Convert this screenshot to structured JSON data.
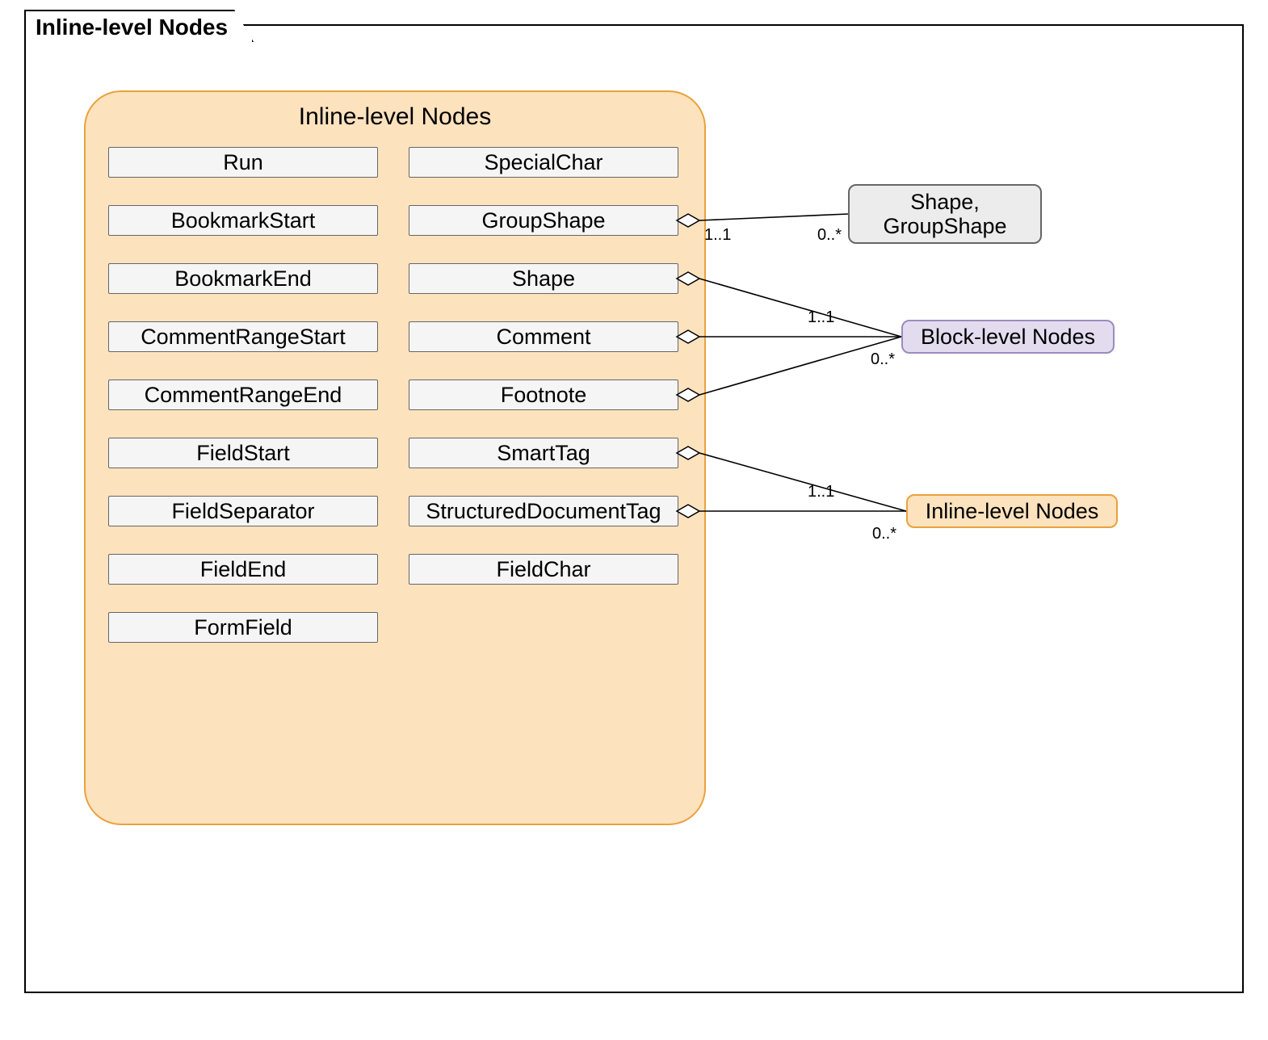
{
  "frame": {
    "title": "Inline-level Nodes"
  },
  "container": {
    "title": "Inline-level Nodes"
  },
  "left_col": [
    "Run",
    "BookmarkStart",
    "BookmarkEnd",
    "CommentRangeStart",
    "CommentRangeEnd",
    "FieldStart",
    "FieldSeparator",
    "FieldEnd",
    "FormField"
  ],
  "right_col": [
    "SpecialChar",
    "GroupShape",
    "Shape",
    "Comment",
    "Footnote",
    "SmartTag",
    "StructuredDocumentTag",
    "FieldChar"
  ],
  "external": {
    "shape_group": "Shape,\nGroupShape",
    "block_level": "Block-level Nodes",
    "inline_level": "Inline-level Nodes"
  },
  "multiplicity": {
    "one_one": "1..1",
    "zero_many": "0..*"
  },
  "colors": {
    "container_fill": "#FDE2BE",
    "container_border": "#E9A23B",
    "node_fill": "#F5F5F5",
    "node_border": "#666666",
    "purple_fill": "#E3DCEF",
    "purple_border": "#9B8BC0",
    "grey_fill": "#ECECEC"
  }
}
